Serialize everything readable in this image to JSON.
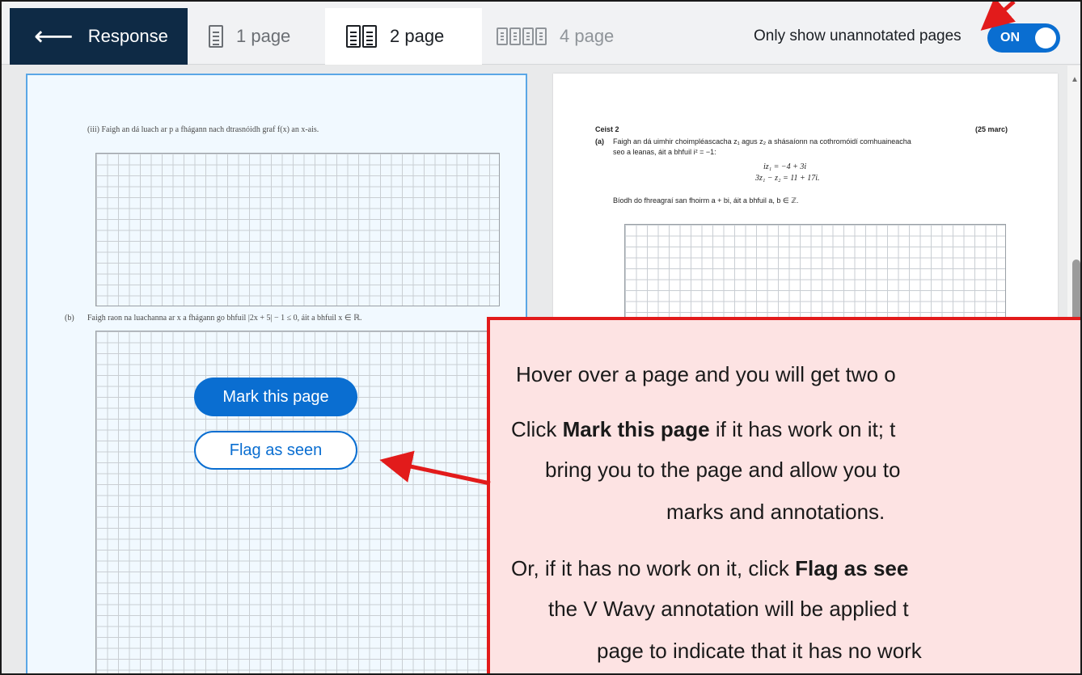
{
  "toolbar": {
    "back_label": "Response",
    "tabs": [
      {
        "label": "1 page"
      },
      {
        "label": "2 page"
      },
      {
        "label": "4 page"
      }
    ],
    "toggle_label": "Only show unannotated pages",
    "toggle_state": "ON"
  },
  "left_page": {
    "q_iii": "(iii)   Faigh an dá luach ar p a fhágann nach dtrasnóidh graf f(x) an x-ais.",
    "q_b_num": "(b)",
    "q_b": "Faigh raon na luachanna ar x a fhágann go bhfuil |2x + 5| − 1 ≤ 0,  áit a bhfuil x ∈ ℝ.",
    "mark_button": "Mark this page",
    "flag_button": "Flag as seen"
  },
  "right_page": {
    "heading": "Ceist 2",
    "marks": "(25 marc)",
    "part_a_num": "(a)",
    "part_a_line1": "Faigh an dá uimhir choimpléascacha  z₁ agus z₂ a shásaíonn na cothromóidí comhuaineacha",
    "part_a_line2": "seo a leanas, áit a bhfuil  i² = −1:",
    "eq1": "iz₁       = −4 + 3i",
    "eq2": "3z₁ − z₂ = 11 + 17i.",
    "answer_form": "Bíodh do fhreagraí san fhoirm a + bi, áit a bhfuil a, b ∈ ℤ."
  },
  "callout": {
    "line1": "Hover over a page and you will get two o",
    "line2_bold": "Mark this page",
    "line2_pre": "Click ",
    "line2_post": " if it has work on it; t",
    "line3": "bring you to the page and allow you to",
    "line4": "marks and annotations.",
    "line5_pre": "Or, if it has no work on it, click ",
    "line5_bold": "Flag as see",
    "line6": "the V Wavy annotation will be applied t",
    "line7": "page to indicate that it has no work"
  },
  "colors": {
    "accent": "#0a6ed1",
    "back_button": "#0e2a45",
    "callout_border": "#e21b1b",
    "callout_fill": "#fde3e3"
  }
}
